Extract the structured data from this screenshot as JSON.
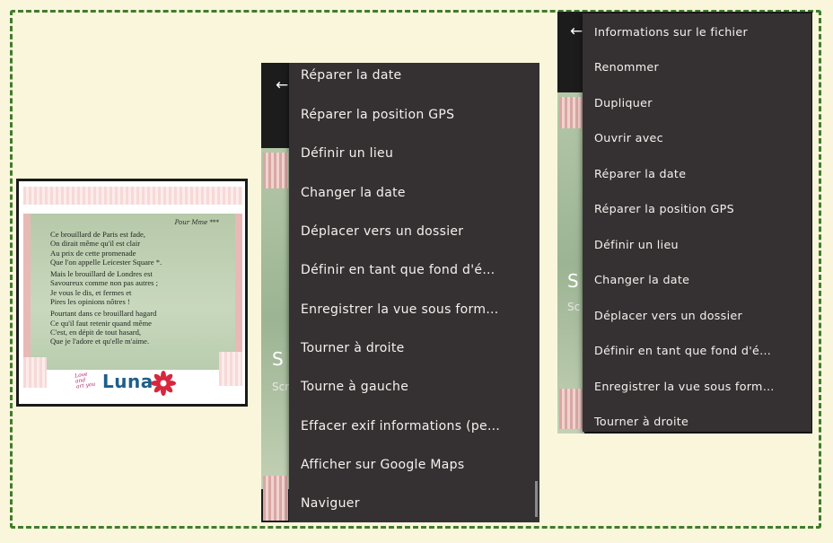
{
  "poem_card": {
    "heading": "Pour Mme ***",
    "stanzas": [
      [
        "Ce brouillard de Paris est fade,",
        "On dirait même qu'il est clair",
        "Au prix de cette promenade",
        "Que l'on appelle Leicester Square *."
      ],
      [
        "Mais le brouillard de Londres est",
        "Savoureux comme non pas autres ;",
        "Je vous le dis, et fermes et",
        "Pires les opinions nôtres !"
      ],
      [
        "Pourtant dans ce brouillard hagard",
        "Ce qu'il faut retenir quand même",
        "C'est, en dépit de tout hasard,",
        "Que je l'adore et qu'elle m'aime."
      ]
    ],
    "signature": "Love and art you",
    "brand": "Luna",
    "flower_color": "#d7263d"
  },
  "phone_left": {
    "back_icon": "arrow-left-icon",
    "bg_title_fragment": "S",
    "bg_caption_fragment": "Scr",
    "menu_items": [
      "Réparer la date",
      "Réparer la position GPS",
      "Définir un lieu",
      "Changer la date",
      "Déplacer vers un dossier",
      "Définir en tant que fond d'é…",
      "Enregistrer la vue sous form…",
      "Tourner à droite",
      "Tourne à gauche",
      "Effacer exif informations (pe…",
      "Afficher sur Google Maps",
      "Naviguer"
    ]
  },
  "phone_right": {
    "back_icon": "arrow-left-icon",
    "bg_title_fragment": "S",
    "bg_caption_fragment": "Sc",
    "menu_items": [
      "Informations sur le fichier",
      "Renommer",
      "Dupliquer",
      "Ouvrir avec",
      "Réparer la date",
      "Réparer la position GPS",
      "Définir un lieu",
      "Changer la date",
      "Déplacer vers un dossier",
      "Définir en tant que fond d'é…",
      "Enregistrer la vue sous form…",
      "Tourner à droite"
    ]
  },
  "colors": {
    "page_background": "#faf6dc",
    "border": "#3f7d2a",
    "menu_background": "#353132",
    "menu_text": "#f4f1ef"
  }
}
